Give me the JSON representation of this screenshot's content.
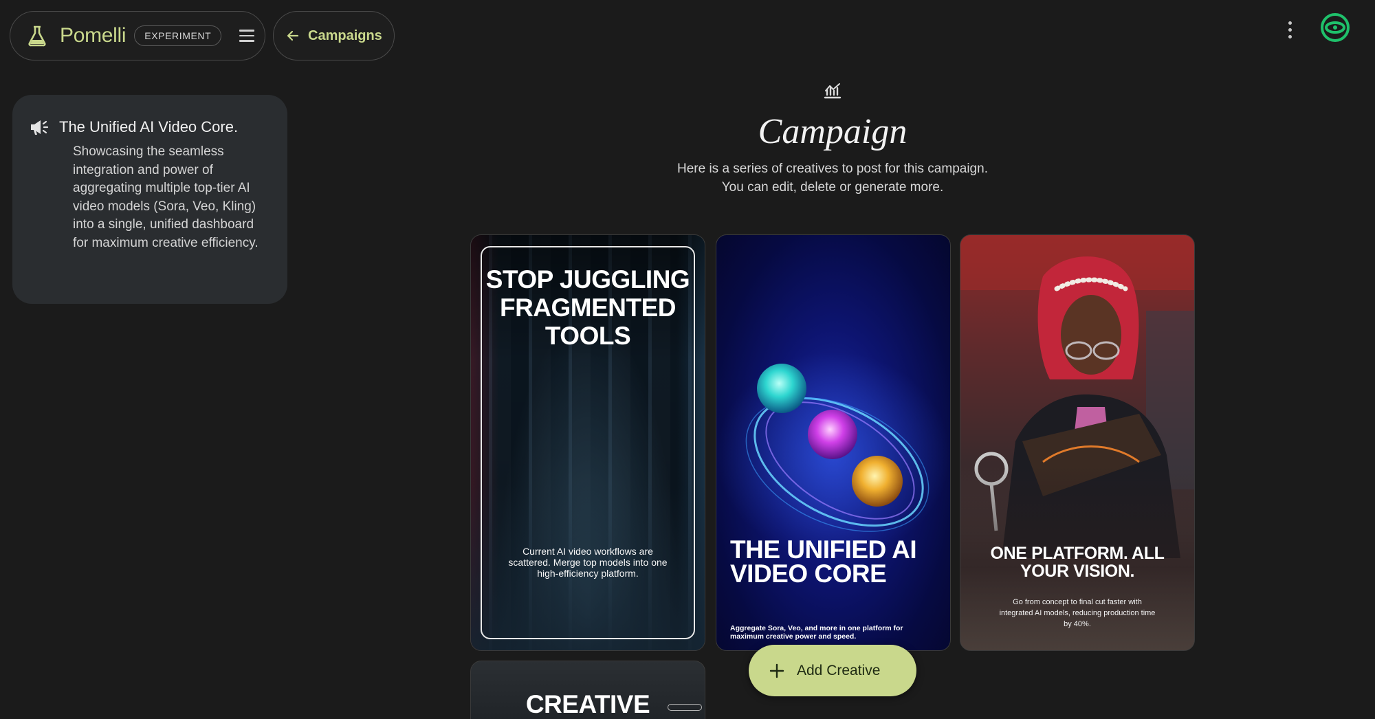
{
  "header": {
    "brand": "Pomelli",
    "badge": "EXPERIMENT",
    "back_label": "Campaigns"
  },
  "brief": {
    "title": "The Unified AI Video Core.",
    "body": "Showcasing the seamless integration and power of aggregating multiple top-tier AI video models (Sora, Veo, Kling) into a single, unified dashboard for maximum creative efficiency."
  },
  "main": {
    "title": "Campaign",
    "subtitle_line1": "Here is a series of creatives to post for this campaign.",
    "subtitle_line2": "You can edit, delete or generate more."
  },
  "creatives": [
    {
      "headline_1": "STOP JUGGLING",
      "headline_2": "FRAGMENTED",
      "headline_3": "TOOLS",
      "body": "Current AI video workflows are scattered. Merge top models into one high-efficiency platform."
    },
    {
      "headline_1": "THE UNIFIED AI",
      "headline_2": "VIDEO CORE",
      "body": "Aggregate Sora, Veo, and more in one platform for maximum creative power and speed."
    },
    {
      "headline_1": "ONE PLATFORM. ALL",
      "headline_2": "YOUR VISION.",
      "body": "Go from concept to final cut faster with integrated AI models, reducing production time by 40%."
    },
    {
      "headline_1": "CREATIVE"
    }
  ],
  "actions": {
    "add_creative": "Add Creative"
  },
  "colors": {
    "accent": "#c9d88c",
    "background": "#1b1b1b",
    "avatar_ring": "#1fc16b"
  },
  "icons": {
    "brand": "flask-icon",
    "menu": "menu-icon",
    "back": "arrow-back-icon",
    "more": "more-vert-icon",
    "brief": "campaign-megaphone-icon",
    "campaign": "campaign-icon",
    "add": "add-icon"
  }
}
